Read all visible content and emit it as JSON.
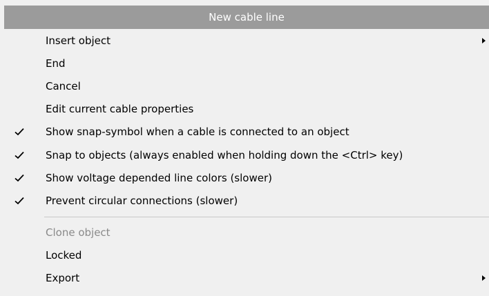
{
  "menu": {
    "title": "New cable line",
    "header_color": "#9b9b9b",
    "items": [
      {
        "label": "Insert object",
        "checked": false,
        "submenu": true,
        "disabled": false
      },
      {
        "label": "End",
        "checked": false,
        "submenu": false,
        "disabled": false
      },
      {
        "label": "Cancel",
        "checked": false,
        "submenu": false,
        "disabled": false
      },
      {
        "label": "Edit current cable properties",
        "checked": false,
        "submenu": false,
        "disabled": false
      },
      {
        "label": "Show snap-symbol when a cable is connected to an object",
        "checked": true,
        "submenu": false,
        "disabled": false
      },
      {
        "label": "Snap to objects (always enabled when holding down the <Ctrl> key)",
        "checked": true,
        "submenu": false,
        "disabled": false
      },
      {
        "label": "Show voltage depended line colors (slower)",
        "checked": true,
        "submenu": false,
        "disabled": false
      },
      {
        "label": "Prevent circular connections (slower)",
        "checked": true,
        "submenu": false,
        "disabled": false
      }
    ],
    "items_after_separator": [
      {
        "label": "Clone object",
        "checked": false,
        "submenu": false,
        "disabled": true
      },
      {
        "label": "Locked",
        "checked": false,
        "submenu": false,
        "disabled": false
      },
      {
        "label": "Export",
        "checked": false,
        "submenu": true,
        "disabled": false
      }
    ]
  }
}
